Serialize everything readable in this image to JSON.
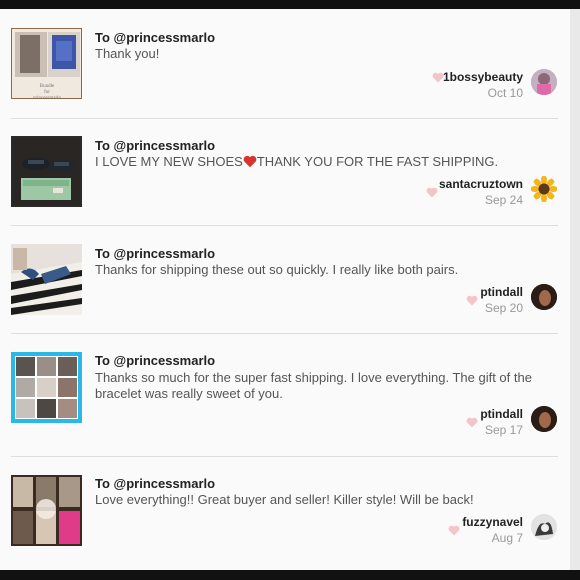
{
  "reviews": [
    {
      "to": "To @princessmarlo",
      "message": "Thank you!",
      "username": "1bossybeauty",
      "date": "Oct 10",
      "thumb_caption": "Bundle\nfor\nprincessmarlo"
    },
    {
      "to": "To @princessmarlo",
      "message_before": "I LOVE MY NEW SHOES",
      "message_after": "THANK YOU FOR THE FAST SHIPPING.",
      "username": "santacruztown",
      "date": "Sep 24"
    },
    {
      "to": "To @princessmarlo",
      "message": "Thanks for shipping these out so quickly. I really like both pairs.",
      "username": "ptindall",
      "date": "Sep 20"
    },
    {
      "to": "To @princessmarlo",
      "message": "Thanks so much for the super fast shipping. I love everything. The gift of the bracelet was really sweet of you.",
      "username": "ptindall",
      "date": "Sep 17"
    },
    {
      "to": "To @princessmarlo",
      "message": "Love everything!! Great buyer and seller! Killer style! Will be back!",
      "username": "fuzzynavel",
      "date": "Aug 7"
    }
  ],
  "colors": {
    "heart": "#f4c4c8",
    "heart_emoji": "#d8342c",
    "divider": "#dedede",
    "frame_blue": "#2ab8e6"
  }
}
